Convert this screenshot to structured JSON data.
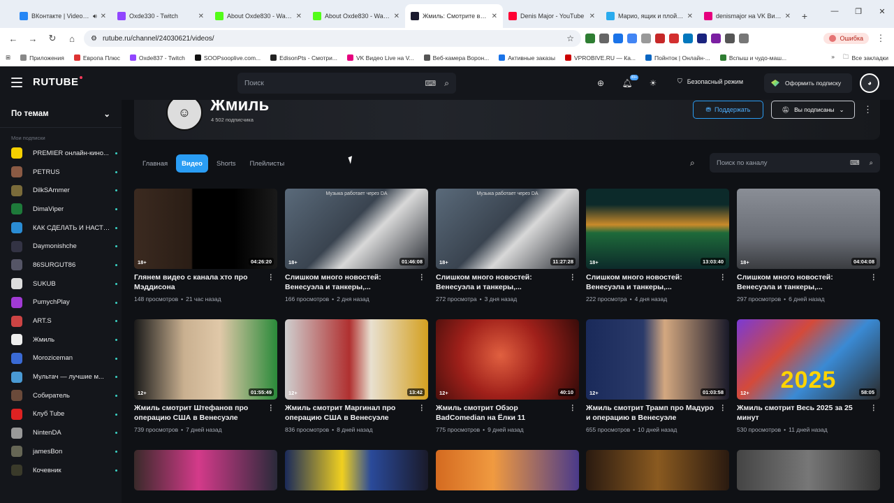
{
  "browser": {
    "tabs": [
      {
        "title": "ВКонтакте | Video Ext",
        "color": "#2787f5",
        "muted": true
      },
      {
        "title": "Oxde330 - Twitch",
        "color": "#9146ff"
      },
      {
        "title": "About Oxde830 - Watch L",
        "color": "#53fc18"
      },
      {
        "title": "About Oxde830 - Watch L",
        "color": "#53fc18"
      },
      {
        "title": "Жмиль: Смотрите видео",
        "color": "#1a1a2e",
        "active": true
      },
      {
        "title": "Denis Major - YouTube",
        "color": "#ff0033"
      },
      {
        "title": "Марио, ящик и плойка -",
        "color": "#2aabee"
      },
      {
        "title": "denismajor на VK Видео",
        "color": "#e6007e"
      }
    ],
    "new_tab": "+",
    "url": "rutube.ru/channel/24030621/videos/",
    "error_label": "Ошибка",
    "bookmarks": [
      {
        "label": "Приложения",
        "color": "#888"
      },
      {
        "label": "Европа Плюс",
        "color": "#d33"
      },
      {
        "label": "Oxde837 - Twitch",
        "color": "#9146ff"
      },
      {
        "label": "SOOPsooplive.com...",
        "color": "#111"
      },
      {
        "label": "EdisonPts - Смотри...",
        "color": "#222"
      },
      {
        "label": "VK Видео Live на V...",
        "color": "#e6007e"
      },
      {
        "label": "Веб-камера Ворон...",
        "color": "#555"
      },
      {
        "label": "Активные заказы",
        "color": "#1a73e8"
      },
      {
        "label": "VPROBIVE.RU — Ка...",
        "color": "#c00"
      },
      {
        "label": "Пойнток | Онлайн-...",
        "color": "#0a66c2"
      },
      {
        "label": "Вспыш и чудо-маш...",
        "color": "#2e7d32"
      }
    ],
    "all_bookmarks": "Все закладки"
  },
  "header": {
    "logo": "RUTUBE",
    "search_placeholder": "Поиск",
    "notif_badge": "99+",
    "safe_mode": "Безопасный режим",
    "subscribe_label": "Оформить подписку"
  },
  "sidebar": {
    "title": "По темам",
    "caption": "Мои подписки",
    "items": [
      {
        "label": "PREMIER онлайн-кино...",
        "color": "#f5d000"
      },
      {
        "label": "PETRUS",
        "color": "#8a5a44"
      },
      {
        "label": "DilkSAmmer",
        "color": "#7a6b3a"
      },
      {
        "label": "DimaViper",
        "color": "#1e7a3a"
      },
      {
        "label": "КАК СДЕЛАТЬ И НАСТР...",
        "color": "#2a8cd4"
      },
      {
        "label": "Daymonishche",
        "color": "#334"
      },
      {
        "label": "86SURGUT86",
        "color": "#556"
      },
      {
        "label": "SUKUB",
        "color": "#ddd"
      },
      {
        "label": "PumychPlay",
        "color": "#a13ad4"
      },
      {
        "label": "ART.S",
        "color": "#c44"
      },
      {
        "label": "Жмиль",
        "color": "#eee"
      },
      {
        "label": "Moroziceman",
        "color": "#3a6ad4"
      },
      {
        "label": "Мультач — лучшие м...",
        "color": "#4a9ad4"
      },
      {
        "label": "Собиратель",
        "color": "#6a4a3a"
      },
      {
        "label": "Клуб Tube",
        "color": "#d22"
      },
      {
        "label": "NintenDA",
        "color": "#999"
      },
      {
        "label": "jamesBon",
        "color": "#665"
      },
      {
        "label": "Кочевник",
        "color": "#3a3a2a"
      }
    ]
  },
  "channel": {
    "name": "Жмиль",
    "subscribers": "4 502 подписчика",
    "support_label": "Поддержать",
    "subscribed_label": "Вы подписаны",
    "tabs": [
      "Главная",
      "Видео",
      "Shorts",
      "Плейлисты"
    ],
    "active_tab": "Видео",
    "search_placeholder": "Поиск по каналу"
  },
  "videos": [
    {
      "title": "Глянем видео с канала хто про Мэддисона",
      "views": "148 просмотров",
      "ago": "21 час назад",
      "age": "18+",
      "duration": "04:26:20",
      "bg": "linear-gradient(90deg,#3b2a20 0%,#2a1d15 40%,#000 41%,#000 70%,#1a1a1a 100%)"
    },
    {
      "title": "Слишком много новостей: Венесуэла и танкеры,...",
      "views": "166 просмотров",
      "ago": "2 дня назад",
      "age": "18+",
      "duration": "01:46:08",
      "bg": "linear-gradient(135deg,#5a6a7a 0%,#3a4450 45%,#d8d8d8 60%,#2a2e35 100%)",
      "overlay": "Музыка работает через DA"
    },
    {
      "title": "Слишком много новостей: Венесуэла и танкеры,...",
      "views": "272 просмотра",
      "ago": "3 дня назад",
      "age": "18+",
      "duration": "11:27:28",
      "bg": "linear-gradient(135deg,#5a6a7a 0%,#3a4450 45%,#d8d8d8 60%,#2a2e35 100%)",
      "overlay": "Музыка работает через DA"
    },
    {
      "title": "Слишком много новостей: Венесуэла и танкеры,...",
      "views": "222 просмотра",
      "ago": "4 дня назад",
      "age": "18+",
      "duration": "13:03:40",
      "bg": "linear-gradient(180deg,#0c2a2a 0%,#0c2a2a 20%,#c98a2a 45%,#1e6a3a 55%,#0c2a2a 100%)"
    },
    {
      "title": "Слишком много новостей: Венесуэла и танкеры,...",
      "views": "297 просмотров",
      "ago": "6 дней назад",
      "age": "18+",
      "duration": "04:04:08",
      "bg": "linear-gradient(180deg,#8a8e96 0%,#6a6e76 60%,#3a3c40 100%)"
    },
    {
      "title": "Жмиль смотрит Штефанов про операцию США в Венесуэле",
      "views": "739 просмотров",
      "ago": "7 дней назад",
      "age": "12+",
      "duration": "01:55:49",
      "bg": "linear-gradient(90deg,#1a1a1a 0%,#c9b090 35%,#e0c8a8 60%,#2a8a3a 100%)"
    },
    {
      "title": "Жмиль смотрит Маргинал про операцию США в Венесуэле",
      "views": "836 просмотров",
      "ago": "8 дней назад",
      "age": "12+",
      "duration": "13:42",
      "bg": "linear-gradient(90deg,#cfcfcf 0%,#b03030 45%,#e8e0d0 60%,#d4a020 100%)"
    },
    {
      "title": "Жмиль смотрит Обзор BadComedian на Ёлки 11",
      "views": "775 просмотров",
      "ago": "9 дней назад",
      "age": "12+",
      "duration": "40:10",
      "bg": "radial-gradient(circle at 45% 45%,#e06040 0%,#a0201a 45%,#300a08 100%)"
    },
    {
      "title": "Жмиль смотрит Трамп про Мадуро и операцию в Венесуэле",
      "views": "655 просмотров",
      "ago": "10 дней назад",
      "age": "12+",
      "duration": "01:03:58",
      "bg": "linear-gradient(90deg,#1a2a5a 0%,#2a3a6a 40%,#d4a880 55%,#1a1a2a 100%)"
    },
    {
      "title": "Жмиль смотрит Весь 2025 за 25 минут",
      "views": "530 просмотров",
      "ago": "11 дней назад",
      "age": "12+",
      "duration": "58:05",
      "bg": "linear-gradient(135deg,#7a3ad4 0%,#d44a3a 35%,#3a8ad4 60%,#2a2a2a 100%)",
      "big": "2025"
    }
  ],
  "bottom_thumbs": [
    {
      "bg": "linear-gradient(90deg,#3a2a2a 0%,#d43a8a 45%,#2a2a3a 100%)"
    },
    {
      "bg": "linear-gradient(90deg,#1a2a5a 0%,#f0d020 40%,#2a4a9a 60%,#1a1a2a 100%)"
    },
    {
      "bg": "linear-gradient(90deg,#d46a20 0%,#f09a40 40%,#4a3a8a 100%)"
    },
    {
      "bg": "linear-gradient(90deg,#2a1a10 0%,#8a5a20 50%,#2a1a10 100%)"
    },
    {
      "bg": "linear-gradient(90deg,#444 0%,#777 50%,#333 100%)"
    }
  ]
}
